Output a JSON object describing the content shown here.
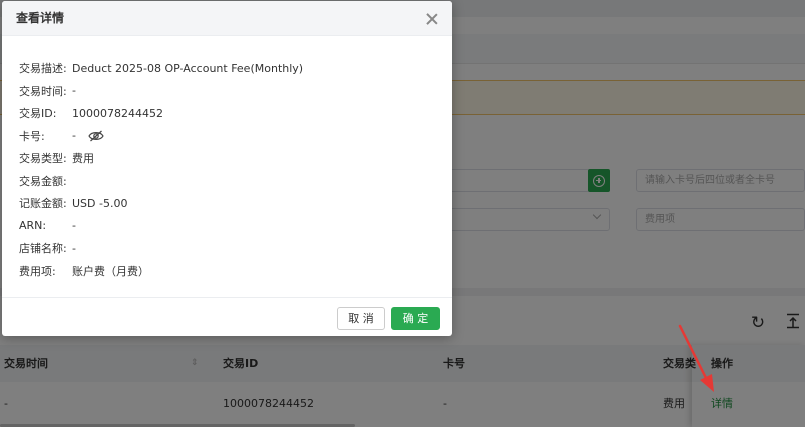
{
  "modal": {
    "title": "查看详情",
    "fields": [
      {
        "key": "交易描述:",
        "value": "Deduct 2025-08 OP-Account Fee(Monthly)"
      },
      {
        "key": "交易时间:",
        "value": "-"
      },
      {
        "key": "交易ID:",
        "value": "1000078244452"
      },
      {
        "key": "卡号:",
        "value": "-"
      },
      {
        "key": "交易类型:",
        "value": "费用"
      },
      {
        "key": "交易金额:",
        "value": ""
      },
      {
        "key": "记账金额:",
        "value": "USD -5.00"
      },
      {
        "key": "ARN:",
        "value": "-"
      },
      {
        "key": "店铺名称:",
        "value": "-"
      },
      {
        "key": "费用项:",
        "value": "账户费（月费）"
      }
    ],
    "cancel_label": "取 消",
    "ok_label": "确 定"
  },
  "filters": {
    "card_placeholder": "请输入卡号后四位或者全卡号",
    "fee_placeholder": "费用项"
  },
  "table": {
    "headers": {
      "time": "交易时间",
      "id": "交易ID",
      "card": "卡号",
      "type": "交易类",
      "op": "操作"
    },
    "row": {
      "time": "-",
      "id": "1000078244452",
      "card": "-",
      "type": "费用",
      "op": "详情"
    }
  },
  "colors": {
    "primary_green": "#2aaa52",
    "annotation_red": "#e53935"
  },
  "icons": {
    "close": "close-icon",
    "eye": "eye-slash-icon",
    "refresh": "refresh-icon",
    "export": "export-icon",
    "add": "plus-circle-icon",
    "sort": "sort-icon"
  }
}
